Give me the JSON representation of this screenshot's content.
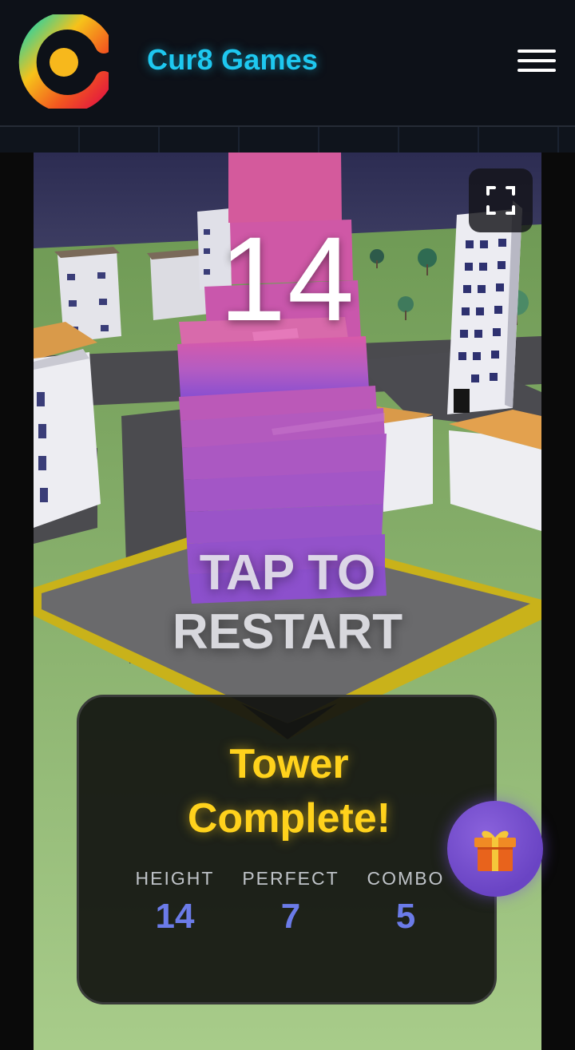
{
  "header": {
    "brand": "Cur8 Games",
    "logo_icon": "cur8-logo-icon",
    "menu_icon": "hamburger-menu-icon",
    "brand_color": "#1ec8f0"
  },
  "game": {
    "score": "14",
    "restart_line1": "TAP TO",
    "restart_line2": "RESTART",
    "fullscreen_icon": "fullscreen-icon"
  },
  "result_panel": {
    "title_line1": "Tower",
    "title_line2": "Complete!",
    "stats": [
      {
        "label": "HEIGHT",
        "value": "14"
      },
      {
        "label": "PERFECT",
        "value": "7"
      },
      {
        "label": "COMBO",
        "value": "5"
      }
    ],
    "title_color": "#ffd21c",
    "value_color": "#6b7be8"
  },
  "gift_button": {
    "icon": "gift-icon"
  }
}
